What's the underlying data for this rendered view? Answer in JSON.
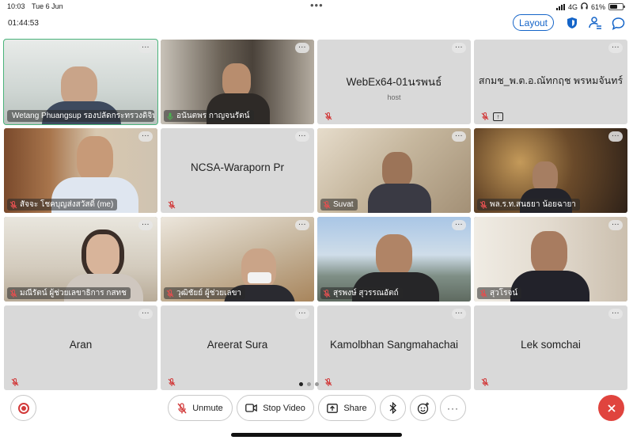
{
  "status_bar": {
    "time": "10:03",
    "date": "Tue 6 Jun",
    "network": "4G",
    "battery": "61%",
    "battery_level": 0.61
  },
  "meeting": {
    "elapsed": "01:44:53"
  },
  "header": {
    "layout_label": "Layout"
  },
  "participants": [
    {
      "name": "Wetang Phuangsup รองปลัดกระทรวงดิจิทัลฯ",
      "type": "video",
      "mic": "on",
      "active": true
    },
    {
      "name": "อนันตพร กาญจนรัตน์",
      "type": "video",
      "mic": "on"
    },
    {
      "name": "WebEx64-01นรพนธ์",
      "subtitle": "host",
      "type": "avatar",
      "mic": "muted"
    },
    {
      "name": "สกมช_พ.ต.อ.ณัทกฤช พรหมจันทร์",
      "type": "avatar",
      "mic": "muted",
      "sharing": true
    },
    {
      "name": "สัจจะ โชคบุญส่งสวัสดิ์ (me)",
      "type": "video",
      "mic": "muted"
    },
    {
      "name": "NCSA-Waraporn Pr",
      "type": "avatar",
      "mic": "muted"
    },
    {
      "name": "Suvat",
      "type": "video",
      "mic": "muted"
    },
    {
      "name": "พล.ร.ท.สนธยา น้อยฉายา",
      "type": "video",
      "mic": "muted"
    },
    {
      "name": "มณีรัตน์ ผู้ช่วยเลขาธิการ กสทช",
      "type": "video",
      "mic": "muted"
    },
    {
      "name": "วุฒิชัยย์ ผู้ช่วยเลขา",
      "type": "video",
      "mic": "muted"
    },
    {
      "name": "สุรพงษ์ สุวรรณอัตถ์",
      "type": "video",
      "mic": "muted"
    },
    {
      "name": "สุวโรจน์",
      "type": "video",
      "mic": "muted"
    },
    {
      "name": "Aran",
      "type": "avatar",
      "mic": "muted"
    },
    {
      "name": "Areerat Sura",
      "type": "avatar",
      "mic": "muted"
    },
    {
      "name": "Kamolbhan Sangmahachai",
      "type": "avatar",
      "mic": "muted"
    },
    {
      "name": "Lek somchai",
      "type": "avatar",
      "mic": "muted"
    }
  ],
  "toolbar": {
    "unmute_label": "Unmute",
    "stop_video_label": "Stop Video",
    "share_label": "Share"
  },
  "colors": {
    "accent": "#1464c8",
    "leave": "#e0443e",
    "muted": "#d23a3a",
    "active_speaker": "#49b37a"
  }
}
